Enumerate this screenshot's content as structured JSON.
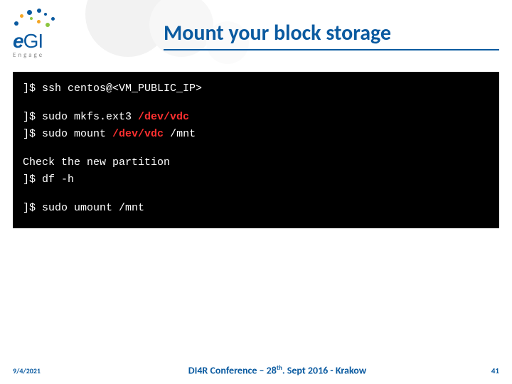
{
  "logo": {
    "brand_e": "e",
    "brand_rest": "GI",
    "sub": "Engage"
  },
  "title": "Mount your block storage",
  "terminal": {
    "line1_prompt": "]$ ",
    "line1_cmd": "ssh centos@<VM_PUBLIC_IP>",
    "line2_prompt": "]$ ",
    "line2_cmd_a": "sudo mkfs.ext3 ",
    "line2_dev": "/dev/vdc",
    "line3_prompt": "]$ ",
    "line3_cmd_a": "sudo mount ",
    "line3_dev": "/dev/vdc",
    "line3_cmd_b": " /mnt",
    "line4_text": "Check the new partition",
    "line5_prompt": "]$ ",
    "line5_cmd": "df -h",
    "line6_prompt": "]$ ",
    "line6_cmd": "sudo umount /mnt"
  },
  "footer": {
    "date": "9/4/2021",
    "conf_a": "DI4R Conference – 28",
    "conf_sup": "th",
    "conf_b": ". Sept 2016 - Krakow",
    "page": "41"
  }
}
